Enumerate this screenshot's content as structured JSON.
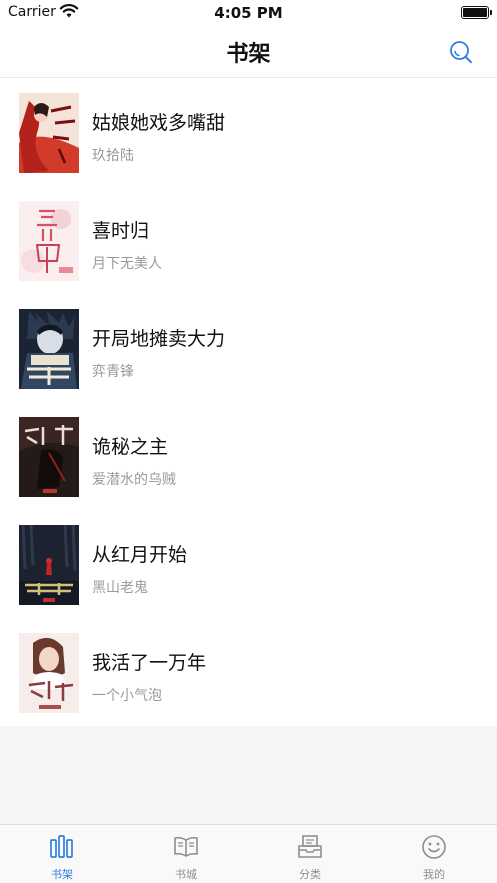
{
  "status_bar": {
    "carrier": "Carrier",
    "time": "4:05 PM"
  },
  "nav": {
    "title": "书架",
    "search_icon": "search-icon",
    "accent": "#2f7fe0"
  },
  "books": [
    {
      "title": "姑娘她戏多嘴甜",
      "author": "玖拾陆",
      "cover_palette": [
        "#c8241c",
        "#f3e3d8"
      ]
    },
    {
      "title": "喜时归",
      "author": "月下无美人",
      "cover_palette": [
        "#f7dede",
        "#d9556b"
      ]
    },
    {
      "title": "开局地摊卖大力",
      "author": "弈青锋",
      "cover_palette": [
        "#1f2a3a",
        "#9aa7bd"
      ]
    },
    {
      "title": "诡秘之主",
      "author": "爱潜水的乌贼",
      "cover_palette": [
        "#2a1d1a",
        "#7a1f1f"
      ]
    },
    {
      "title": "从红月开始",
      "author": "黑山老鬼",
      "cover_palette": [
        "#1c2230",
        "#d6bf7a"
      ]
    },
    {
      "title": "我活了一万年",
      "author": "一个小气泡",
      "cover_palette": [
        "#f5e9e6",
        "#8a3b3b"
      ]
    }
  ],
  "tabs": [
    {
      "label": "书架",
      "icon": "bookshelf-icon",
      "active": true
    },
    {
      "label": "书城",
      "icon": "book-store-icon",
      "active": false
    },
    {
      "label": "分类",
      "icon": "category-icon",
      "active": false
    },
    {
      "label": "我的",
      "icon": "smiley-profile-icon",
      "active": false
    }
  ]
}
